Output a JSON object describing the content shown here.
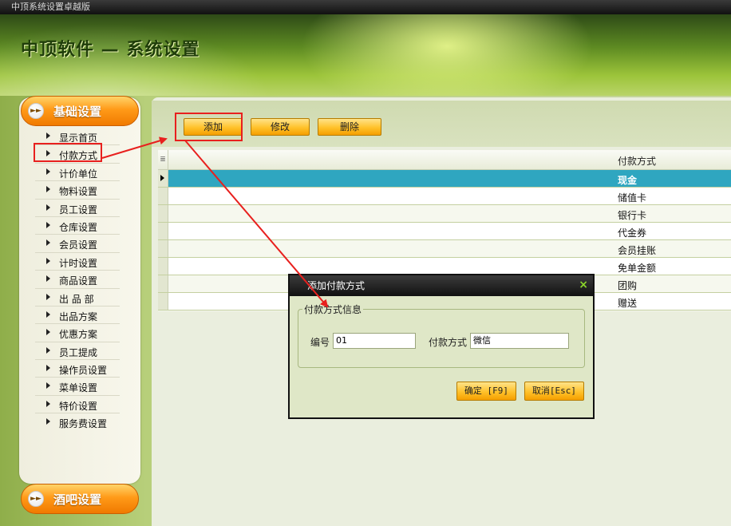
{
  "window": {
    "title": "中顶系统设置卓越版"
  },
  "header": {
    "app_title": "中顶软件 — 系统设置"
  },
  "sidebar": {
    "section_top": "基础设置",
    "section_bottom": "酒吧设置",
    "items": [
      {
        "label": "显示首页"
      },
      {
        "label": "付款方式"
      },
      {
        "label": "计价单位"
      },
      {
        "label": "物料设置"
      },
      {
        "label": "员工设置"
      },
      {
        "label": "仓库设置"
      },
      {
        "label": "会员设置"
      },
      {
        "label": "计时设置"
      },
      {
        "label": "商品设置"
      },
      {
        "label": "出 品 部"
      },
      {
        "label": "出品方案"
      },
      {
        "label": "优惠方案"
      },
      {
        "label": "员工提成"
      },
      {
        "label": "操作员设置"
      },
      {
        "label": "菜单设置"
      },
      {
        "label": "特价设置"
      },
      {
        "label": "服务费设置"
      }
    ]
  },
  "toolbar": {
    "add_label": "添加",
    "edit_label": "修改",
    "delete_label": "删除"
  },
  "grid": {
    "column_header": "付款方式",
    "rows": [
      "现金",
      "储值卡",
      "银行卡",
      "代金券",
      "会员挂账",
      "免单金额",
      "团购",
      "赠送"
    ],
    "selected_index": 0
  },
  "dialog": {
    "title": "添加付款方式",
    "close_symbol": "×",
    "group_label": "付款方式信息",
    "code_label": "编号",
    "code_value": "01",
    "method_label": "付款方式",
    "method_value": "微信",
    "ok_label": "确定 [F9]",
    "cancel_label": "取消[Esc]"
  },
  "colors": {
    "highlight": "#e8201e",
    "selected_row": "#2fa6c0",
    "button": "#ffc12a"
  }
}
